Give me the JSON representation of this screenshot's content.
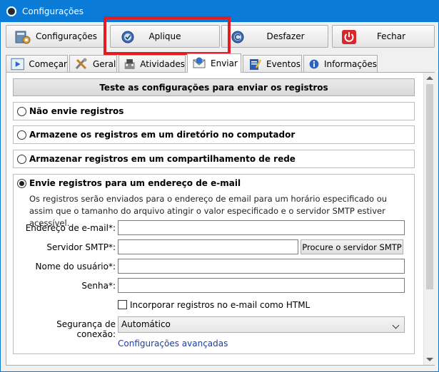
{
  "window": {
    "title": "Configurações"
  },
  "toolbar": {
    "settings_label": "Configurações",
    "apply_label": "Aplique",
    "undo_label": "Desfazer",
    "close_label": "Fechar"
  },
  "tabs": [
    {
      "label": "Começar",
      "icon": "play-icon"
    },
    {
      "label": "Geral",
      "icon": "tools-icon"
    },
    {
      "label": "Atividades",
      "icon": "activities-icon"
    },
    {
      "label": "Enviar",
      "icon": "send-icon",
      "active": true
    },
    {
      "label": "Eventos",
      "icon": "events-icon"
    },
    {
      "label": "Informações",
      "icon": "info-icon"
    }
  ],
  "main": {
    "test_button_label": "Teste as configurações para enviar os registros",
    "options": [
      {
        "label": "Não envie registros",
        "selected": false
      },
      {
        "label": "Armazene os registros em um diretório no computador",
        "selected": false
      },
      {
        "label": "Armazenar registros em um compartilhamento de rede",
        "selected": false
      }
    ],
    "email": {
      "option_label": "Envie registros para um endereço de e-mail",
      "selected": true,
      "description": "Os registros serão enviados para o endereço de email para um horário especificado ou assim que o tamanho do arquivo atingir o valor especificado e o servidor SMTP estiver acessível.",
      "address_label": "Endereço de e-mail*:",
      "address_value": "",
      "smtp_label": "Servidor SMTP*:",
      "smtp_value": "",
      "smtp_button_label": "Procure o servidor SMTP",
      "user_label": "Nome do usuário*:",
      "user_value": "",
      "password_label": "Senha*:",
      "password_value": "",
      "html_checkbox_label": "Incorporar registros no e-mail como HTML",
      "html_checked": false,
      "security_label": "Segurança de conexão:",
      "security_value": "Automático",
      "advanced_link": "Configurações avançadas"
    }
  },
  "colors": {
    "titlebar": "#0a7bd6",
    "highlight": "#e31b23",
    "link": "#1a3ea5"
  }
}
